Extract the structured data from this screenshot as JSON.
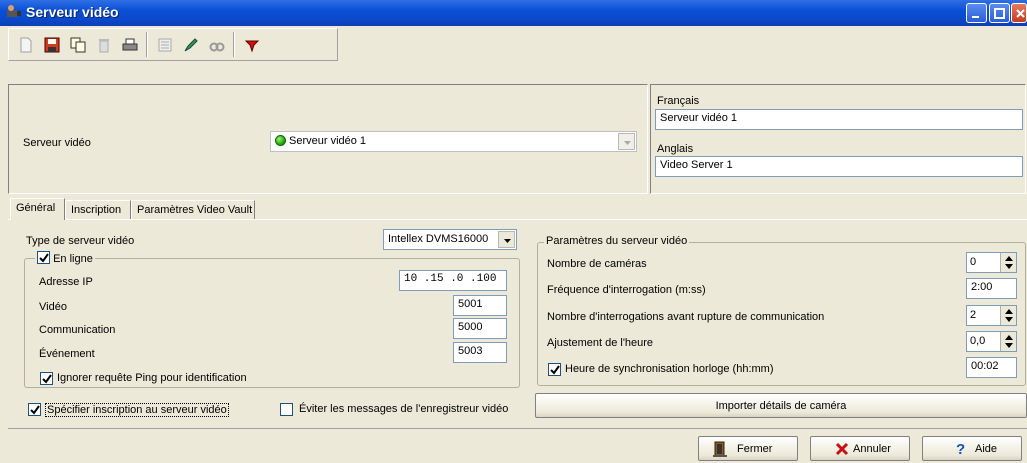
{
  "window": {
    "title": "Serveur vidéo"
  },
  "toolbar": {
    "items": [
      "new-icon",
      "save-icon",
      "copy-icon",
      "delete-icon",
      "print-icon",
      "list-icon",
      "edit-icon",
      "find-icon",
      "tag-icon"
    ]
  },
  "top": {
    "server_label": "Serveur vidéo",
    "server_selected": "Serveur vidéo 1"
  },
  "lang": {
    "fr_label": "Français",
    "fr_value": "Serveur vidéo 1",
    "en_label": "Anglais",
    "en_value": "Video Server 1"
  },
  "tabs": [
    "Général",
    "Inscription",
    "Paramètres Video Vault"
  ],
  "general": {
    "type_label": "Type de serveur vidéo",
    "type_value": "Intellex DVMS16000",
    "online_label": "En ligne",
    "online_checked": true,
    "ip_label": "Adresse IP",
    "ip_value": "10 .15 .0 .100",
    "video_label": "Vidéo",
    "video_value": "5001",
    "comm_label": "Communication",
    "comm_value": "5000",
    "event_label": "Événement",
    "event_value": "5003",
    "ping_label": "Ignorer requête Ping pour identification",
    "ping_checked": true,
    "specify_label": "Spécifier inscription au serveur vidéo",
    "specify_checked": true,
    "avoid_label": "Éviter les messages de l'enregistreur vidéo",
    "avoid_checked": false
  },
  "params": {
    "title": "Paramètres du serveur vidéo",
    "cameras_label": "Nombre de caméras",
    "cameras_value": "0",
    "freq_label": "Fréquence d'interrogation (m:ss)",
    "freq_value": "2:00",
    "polls_label": "Nombre d'interrogations avant rupture de communication",
    "polls_value": "2",
    "adjust_label": "Ajustement de l'heure",
    "adjust_value": "0,0",
    "sync_label": "Heure de synchronisation horloge (hh:mm)",
    "sync_value": "00:02",
    "sync_checked": true,
    "import_button": "Importer détails de caméra"
  },
  "buttons": {
    "close": "Fermer",
    "cancel": "Annuler",
    "help": "Aide"
  }
}
